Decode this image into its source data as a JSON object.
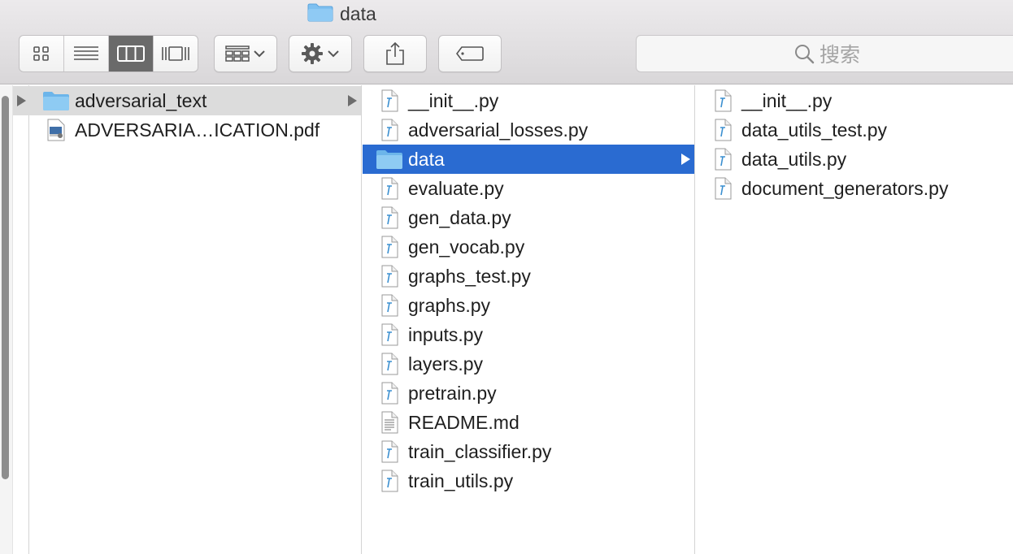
{
  "window": {
    "title": "data"
  },
  "toolbar": {
    "view_modes": [
      "icon-view",
      "list-view",
      "column-view",
      "cover-flow-view"
    ],
    "active_view": "column-view",
    "search": {
      "placeholder": "搜索"
    }
  },
  "colors": {
    "selection_blue": "#2a6bd1",
    "selection_gray": "#dcdcdc",
    "folder_blue": "#7fc0f0"
  },
  "columns": [
    {
      "items": [
        {
          "name": "adversarial_text",
          "kind": "folder",
          "selected": "inactive",
          "has_children": true
        },
        {
          "name": "ADVERSARIA…ICATION.pdf",
          "kind": "pdf"
        }
      ]
    },
    {
      "items": [
        {
          "name": "__init__.py",
          "kind": "python"
        },
        {
          "name": "adversarial_losses.py",
          "kind": "python"
        },
        {
          "name": "data",
          "kind": "folder",
          "selected": "active",
          "has_children": true
        },
        {
          "name": "evaluate.py",
          "kind": "python"
        },
        {
          "name": "gen_data.py",
          "kind": "python"
        },
        {
          "name": "gen_vocab.py",
          "kind": "python"
        },
        {
          "name": "graphs_test.py",
          "kind": "python"
        },
        {
          "name": "graphs.py",
          "kind": "python"
        },
        {
          "name": "inputs.py",
          "kind": "python"
        },
        {
          "name": "layers.py",
          "kind": "python"
        },
        {
          "name": "pretrain.py",
          "kind": "python"
        },
        {
          "name": "README.md",
          "kind": "text"
        },
        {
          "name": "train_classifier.py",
          "kind": "python"
        },
        {
          "name": "train_utils.py",
          "kind": "python"
        }
      ]
    },
    {
      "items": [
        {
          "name": "__init__.py",
          "kind": "python"
        },
        {
          "name": "data_utils_test.py",
          "kind": "python"
        },
        {
          "name": "data_utils.py",
          "kind": "python"
        },
        {
          "name": "document_generators.py",
          "kind": "python"
        }
      ]
    }
  ]
}
